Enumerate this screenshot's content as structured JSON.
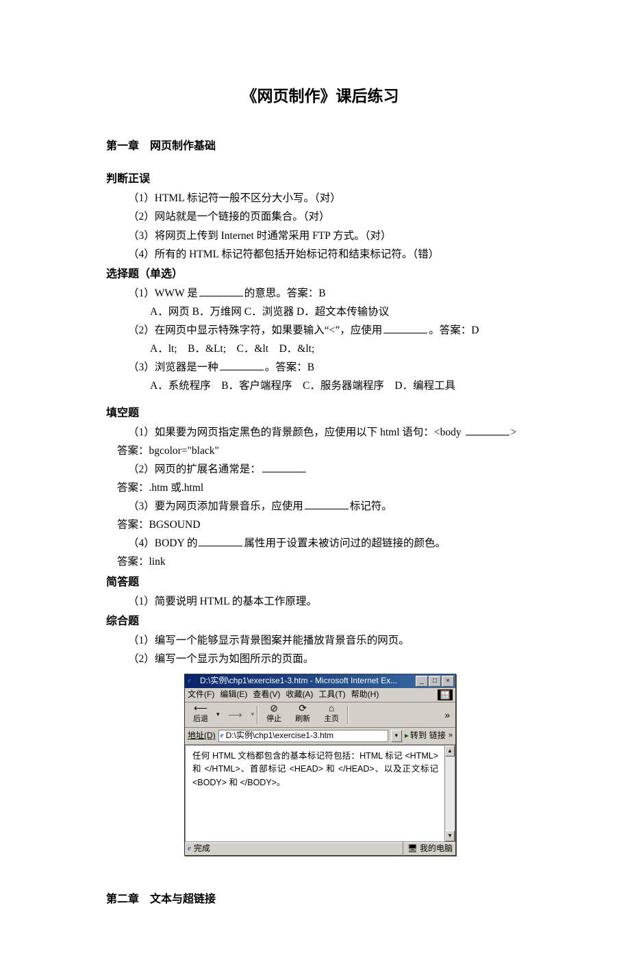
{
  "title": "《网页制作》课后练习",
  "chapter1": {
    "heading": "第一章　网页制作基础",
    "judge": {
      "heading": "判断正误",
      "items": [
        "（1）HTML 标记符一般不区分大小写。（对）",
        "（2）网站就是一个链接的页面集合。（对）",
        "（3）将网页上传到 Internet 时通常采用 FTP 方式。（对）",
        "（4）所有的 HTML 标记符都包括开始标记符和结束标记符。（错）"
      ]
    },
    "choice": {
      "heading": "选择题（单选）",
      "q1": {
        "stem_a": "（1）WWW 是",
        "stem_b": "的意思。答案：B",
        "opts": "A．网页  B．万维网  C．浏览器  D．超文本传输协议"
      },
      "q2": {
        "stem_a": "（2）在网页中显示特殊字符，如果要输入“<”，应使用",
        "stem_b": "。答案：D",
        "opts": "A．lt;　B．&Lt;　C．&lt　D．&lt;"
      },
      "q3": {
        "stem_a": "（3）浏览器是一种",
        "stem_b": "。答案：B",
        "opts": "A．系统程序　B．客户端程序　C．服务器端程序　D．编程工具"
      }
    },
    "fill": {
      "heading": "填空题",
      "q1": {
        "a": "（1）如果要为网页指定黑色的背景颜色，应使用以下 html 语句：<body ",
        "b": ">"
      },
      "a1": "答案：bgcolor=\"black\"",
      "q2": "（2）网页的扩展名通常是：",
      "a2": "答案：.htm 或.html",
      "q3": {
        "a": "（3）要为网页添加背景音乐，应使用",
        "b": "标记符。"
      },
      "a3": "答案：BGSOUND",
      "q4": {
        "a": "（4）BODY 的",
        "b": "属性用于设置未被访问过的超链接的颜色。"
      },
      "a4": "答案：link"
    },
    "short": {
      "heading": "简答题",
      "q1": "（1）简要说明 HTML 的基本工作原理。"
    },
    "comp": {
      "heading": "综合题",
      "q1": "（1）编写一个能够显示背景图案并能播放背景音乐的网页。",
      "q2": "（2）编写一个显示为如图所示的页面。"
    }
  },
  "ie": {
    "title": "D:\\实例\\chp1\\exercise1-3.htm - Microsoft Internet Ex...",
    "menu": {
      "file": "文件(F)",
      "edit": "编辑(E)",
      "view": "查看(V)",
      "fav": "收藏(A)",
      "tool": "工具(T)",
      "help": "帮助(H)"
    },
    "toolbar": {
      "back": "后退",
      "stop": "停止",
      "refresh": "刷新",
      "home": "主页"
    },
    "addr_label": "地址(D)",
    "addr_value": "D:\\实例\\chp1\\exercise1-3.htm",
    "go": "转到",
    "links": "链接",
    "content": "任何 HTML 文档都包含的基本标记符包括：HTML 标记 <HTML> 和 </HTML>、首部标记 <HEAD> 和 </HEAD>、以及正文标记 <BODY> 和 </BODY>。",
    "status_done": "完成",
    "status_zone": "我的电脑"
  },
  "chapter2": {
    "heading": "第二章　文本与超链接"
  }
}
